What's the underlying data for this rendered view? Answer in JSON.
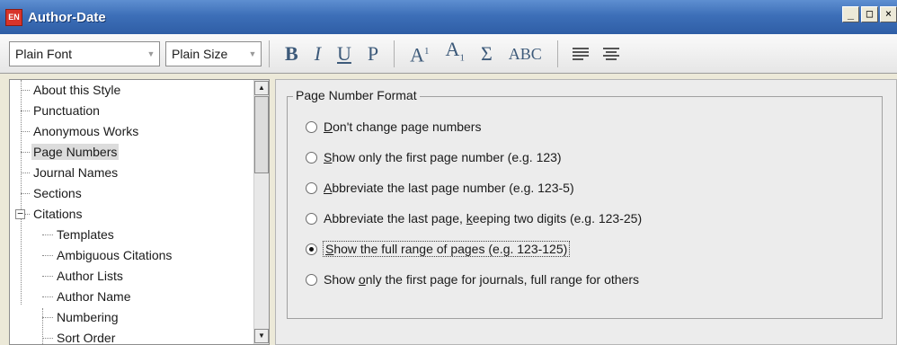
{
  "window": {
    "title": "Author-Date",
    "logo": "EN",
    "controls": [
      "_",
      "□",
      "×"
    ]
  },
  "toolbar": {
    "font_value": "Plain Font",
    "size_value": "Plain Size",
    "format_buttons": [
      "B",
      "I",
      "U",
      "P"
    ],
    "superscript": "A",
    "superscript_mark": "1",
    "subscript": "A",
    "subscript_mark": "1",
    "symbol": "Σ",
    "smallcaps": "ABC"
  },
  "tree": {
    "items": [
      {
        "label": "About this Style"
      },
      {
        "label": "Punctuation"
      },
      {
        "label": "Anonymous Works"
      },
      {
        "label": "Page Numbers"
      },
      {
        "label": "Journal Names"
      },
      {
        "label": "Sections"
      },
      {
        "label": "Citations"
      },
      {
        "label": "Templates"
      },
      {
        "label": "Ambiguous Citations"
      },
      {
        "label": "Author Lists"
      },
      {
        "label": "Author Name"
      },
      {
        "label": "Numbering"
      },
      {
        "label": "Sort Order"
      }
    ],
    "selected": "Page Numbers",
    "expander_symbol": "−"
  },
  "page_number_format": {
    "group_title": "Page Number Format",
    "options": [
      {
        "pre": "",
        "key": "D",
        "post": "on't change page numbers",
        "selected": false
      },
      {
        "pre": "",
        "key": "S",
        "post": "how only the first page number (e.g. 123)",
        "selected": false
      },
      {
        "pre": "",
        "key": "A",
        "post": "bbreviate the last page number (e.g. 123-5)",
        "selected": false
      },
      {
        "pre": "Abbreviate the last page, ",
        "key": "k",
        "post": "eeping two digits (e.g. 123-25)",
        "selected": false
      },
      {
        "pre": "",
        "key": "S",
        "post": "how the full range of pages (e.g. 123-125)",
        "selected": true
      },
      {
        "pre": "Show ",
        "key": "o",
        "post": "nly the first page for journals, full range for others",
        "selected": false
      }
    ]
  }
}
